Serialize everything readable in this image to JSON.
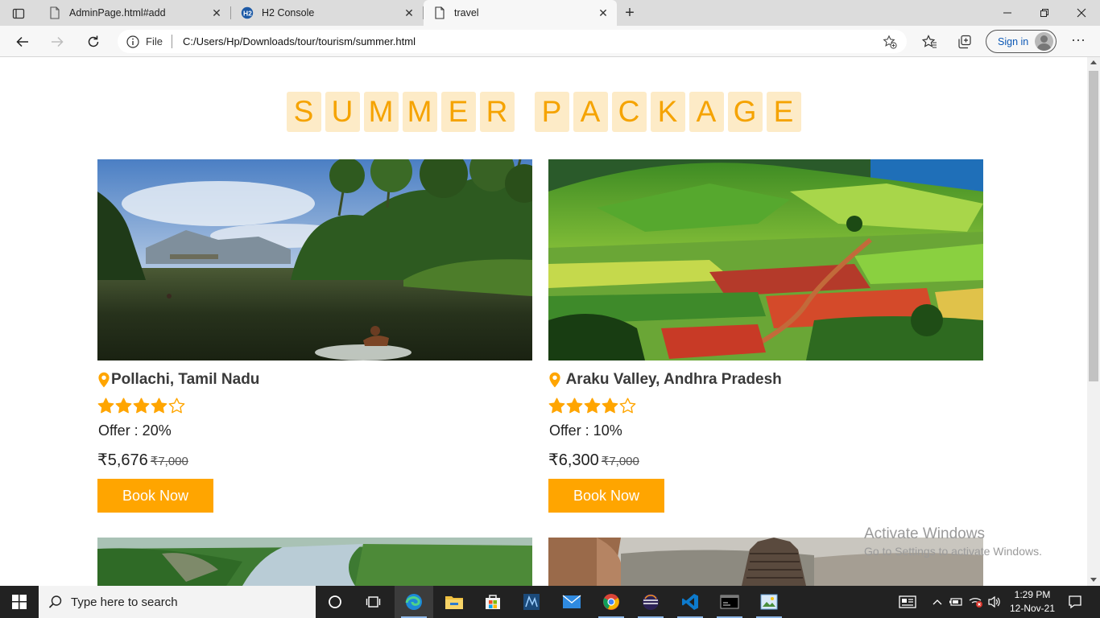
{
  "browser": {
    "tabs": [
      {
        "title": "AdminPage.html#add",
        "active": false
      },
      {
        "title": "H2 Console",
        "active": false
      },
      {
        "title": "travel",
        "active": true
      }
    ],
    "url_scheme": "File",
    "url": "C:/Users/Hp/Downloads/tour/tourism/summer.html",
    "sign_in": "Sign in"
  },
  "page": {
    "heading": "SUMMER PACKAGE",
    "accent_color": "#ffa500",
    "cards": [
      {
        "title": "Pollachi, Tamil Nadu",
        "rating": 4,
        "rating_max": 5,
        "offer": "Offer : 20%",
        "price": "₹5,676",
        "old_price": "₹7,000",
        "button": "Book Now"
      },
      {
        "title": " Araku Valley, Andhra Pradesh",
        "rating": 4,
        "rating_max": 5,
        "offer": "Offer : 10%",
        "price": "₹6,300",
        "old_price": "₹7,000",
        "button": "Book Now"
      }
    ]
  },
  "watermark": {
    "line1": "Activate Windows",
    "line2": "Go to Settings to activate Windows."
  },
  "taskbar": {
    "search_placeholder": "Type here to search",
    "time": "1:29 PM",
    "date": "12-Nov-21"
  }
}
